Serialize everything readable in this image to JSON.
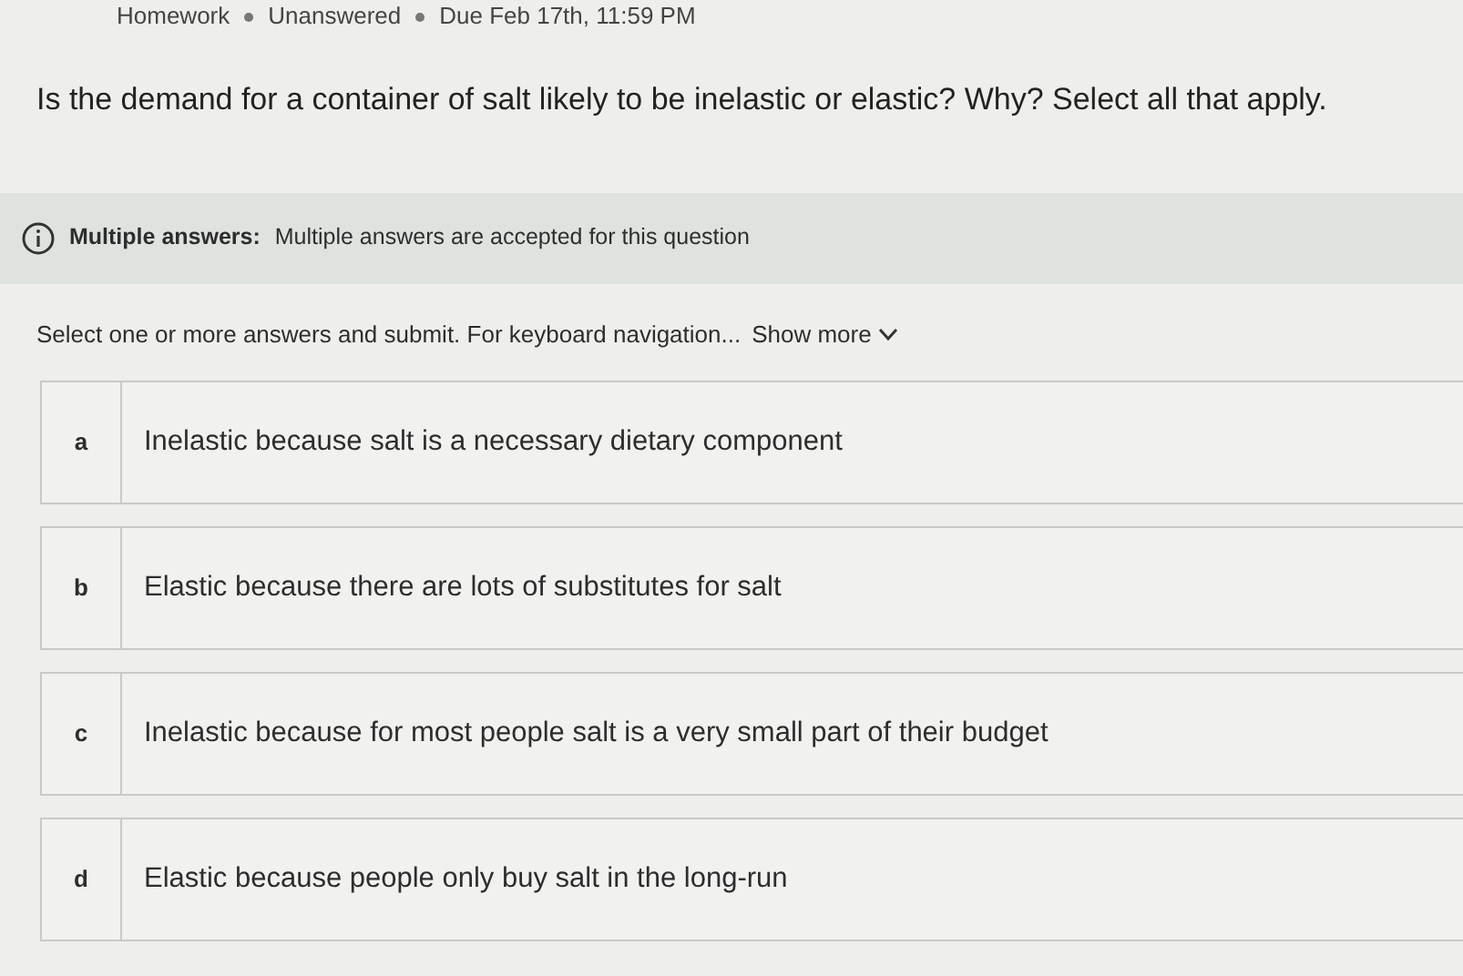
{
  "breadcrumb": [
    "Homework",
    "Unanswered",
    "Due Feb 17th, 11:59 PM"
  ],
  "question": "Is the demand for a container of salt likely to be inelastic or elastic? Why? Select all that apply.",
  "info": {
    "label": "Multiple answers:",
    "text": "Multiple answers are accepted for this question"
  },
  "instructions": {
    "text": "Select one or more answers and submit. For keyboard navigation...",
    "link": "Show more"
  },
  "options": [
    {
      "letter": "a",
      "text": "Inelastic because salt is a necessary dietary component",
      "selected": false
    },
    {
      "letter": "b",
      "text": "Elastic because there are lots of substitutes for salt",
      "selected": false
    },
    {
      "letter": "c",
      "text": "Inelastic because for most people salt is a very small part of their budget",
      "selected": false
    },
    {
      "letter": "d",
      "text": "Elastic because people only buy salt in the long-run",
      "selected": false
    }
  ]
}
